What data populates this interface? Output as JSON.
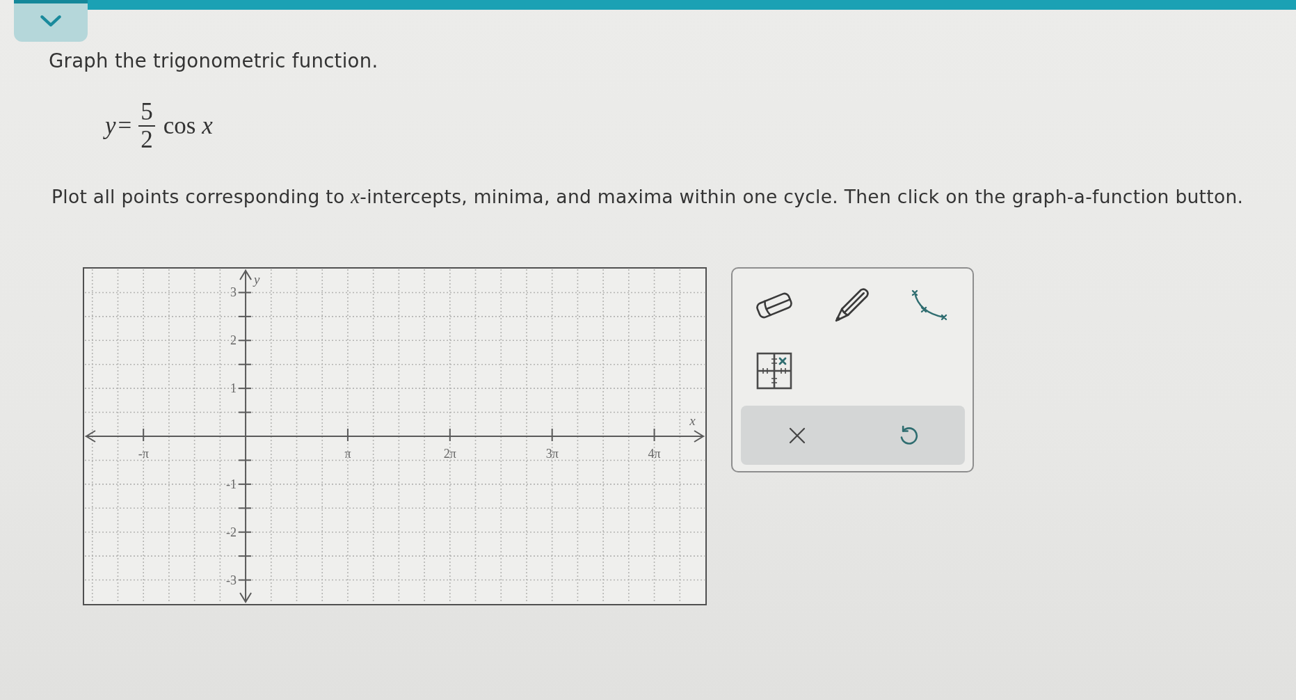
{
  "question": {
    "title": "Graph the trigonometric function.",
    "equation": {
      "lhs": "y",
      "relation": "=",
      "numerator": "5",
      "denominator": "2",
      "rhs": "cos *x*"
    },
    "instruction": "Plot all points corresponding to *x*-intercepts, minima, and maxima within one cycle. Then click on the graph-a-function button."
  },
  "graph": {
    "x_axis_label": "x",
    "y_axis_label": "y",
    "x_tick_labels": [
      "-π",
      "π",
      "2π",
      "3π",
      "4π"
    ],
    "y_tick_labels": [
      "3",
      "2",
      "1",
      "-1",
      "-2",
      "-3"
    ]
  },
  "toolbox": {
    "tools": [
      {
        "kind": "eraser",
        "selected": false
      },
      {
        "kind": "pencil",
        "selected": false
      },
      {
        "kind": "function",
        "selected": false
      },
      {
        "kind": "point",
        "selected": false
      }
    ],
    "actions": [
      {
        "kind": "clear"
      },
      {
        "kind": "undo"
      }
    ]
  }
}
